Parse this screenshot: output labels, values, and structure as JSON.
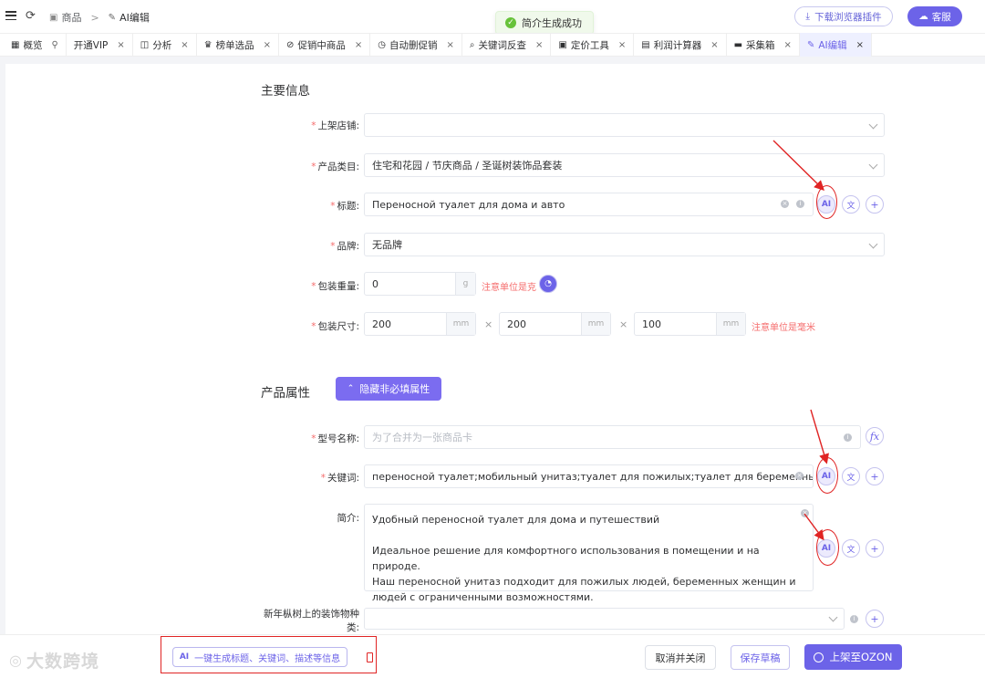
{
  "topbar": {
    "crumb_goods": "商品",
    "crumb_sep": ">",
    "crumb_ai_edit": "AI编辑",
    "toast": "简介生成成功",
    "plugin_button": "下载浏览器插件",
    "service_button": "客服"
  },
  "tabs": [
    {
      "label": "概览",
      "icon": "overview-icon",
      "pin": true
    },
    {
      "label": "开通VIP"
    },
    {
      "label": "分析",
      "icon": "analysis-icon"
    },
    {
      "label": "榜单选品",
      "icon": "ranking-icon"
    },
    {
      "label": "促销中商品",
      "icon": "promo-icon"
    },
    {
      "label": "自动删促销",
      "icon": "auto-icon"
    },
    {
      "label": "关键词反查",
      "icon": "search-icon"
    },
    {
      "label": "定价工具",
      "icon": "pricing-icon"
    },
    {
      "label": "利润计算器",
      "icon": "calculator-icon"
    },
    {
      "label": "采集箱",
      "icon": "box-icon"
    },
    {
      "label": "AI编辑",
      "icon": "edit-icon",
      "active": true
    }
  ],
  "main_info": {
    "heading": "主要信息",
    "store_label": "上架店铺:",
    "store_value": "",
    "category_label": "产品类目:",
    "category_value": "住宅和花园 / 节庆商品 / 圣诞树装饰品套装",
    "title_label": "标题:",
    "title_value": "Переносной туалет для дома и авто",
    "brand_label": "品牌:",
    "brand_value": "无品牌",
    "weight_label": "包装重量:",
    "weight_value": "0",
    "weight_unit": "g",
    "weight_warn": "注意单位是克",
    "size_label": "包装尺寸:",
    "size_length": "200",
    "size_width": "200",
    "size_height": "100",
    "size_unit": "mm",
    "size_times": "×",
    "size_warn": "注意单位是毫米"
  },
  "attributes": {
    "heading": "产品属性",
    "hide_button": "隐藏非必填属性",
    "model_label": "型号名称:",
    "model_placeholder": "为了合并为一张商品卡",
    "keywords_label": "关键词:",
    "keywords_value": "переносной туалет;мобильный унитаз;туалет для пожилых;туалет для беременны",
    "intro_label": "简介:",
    "intro_line1": "Удобный переносной туалет для дома и путешествий",
    "intro_line2": "Идеальное решение для комфортного использования в помещении и на природе.",
    "intro_line3": "Наш переносной унитаз подходит для пожилых людей, беременных женщин и",
    "intro_line4": "людей с ограниченными возможностями.",
    "decor_label_1": "新年枞树上的装饰物种",
    "decor_label_2": "类:"
  },
  "footer": {
    "logo_text": "大数跨境",
    "ai_button": "一键生成标题、关键词、描述等信息",
    "cancel_button": "取消并关闭",
    "draft_button": "保存草稿",
    "ozon_button": "上架至OZON"
  },
  "colors": {
    "accent": "#6c63e8",
    "required": "#f56c6c",
    "annotation": "#e02424",
    "toast_bg": "#f0f9eb"
  }
}
